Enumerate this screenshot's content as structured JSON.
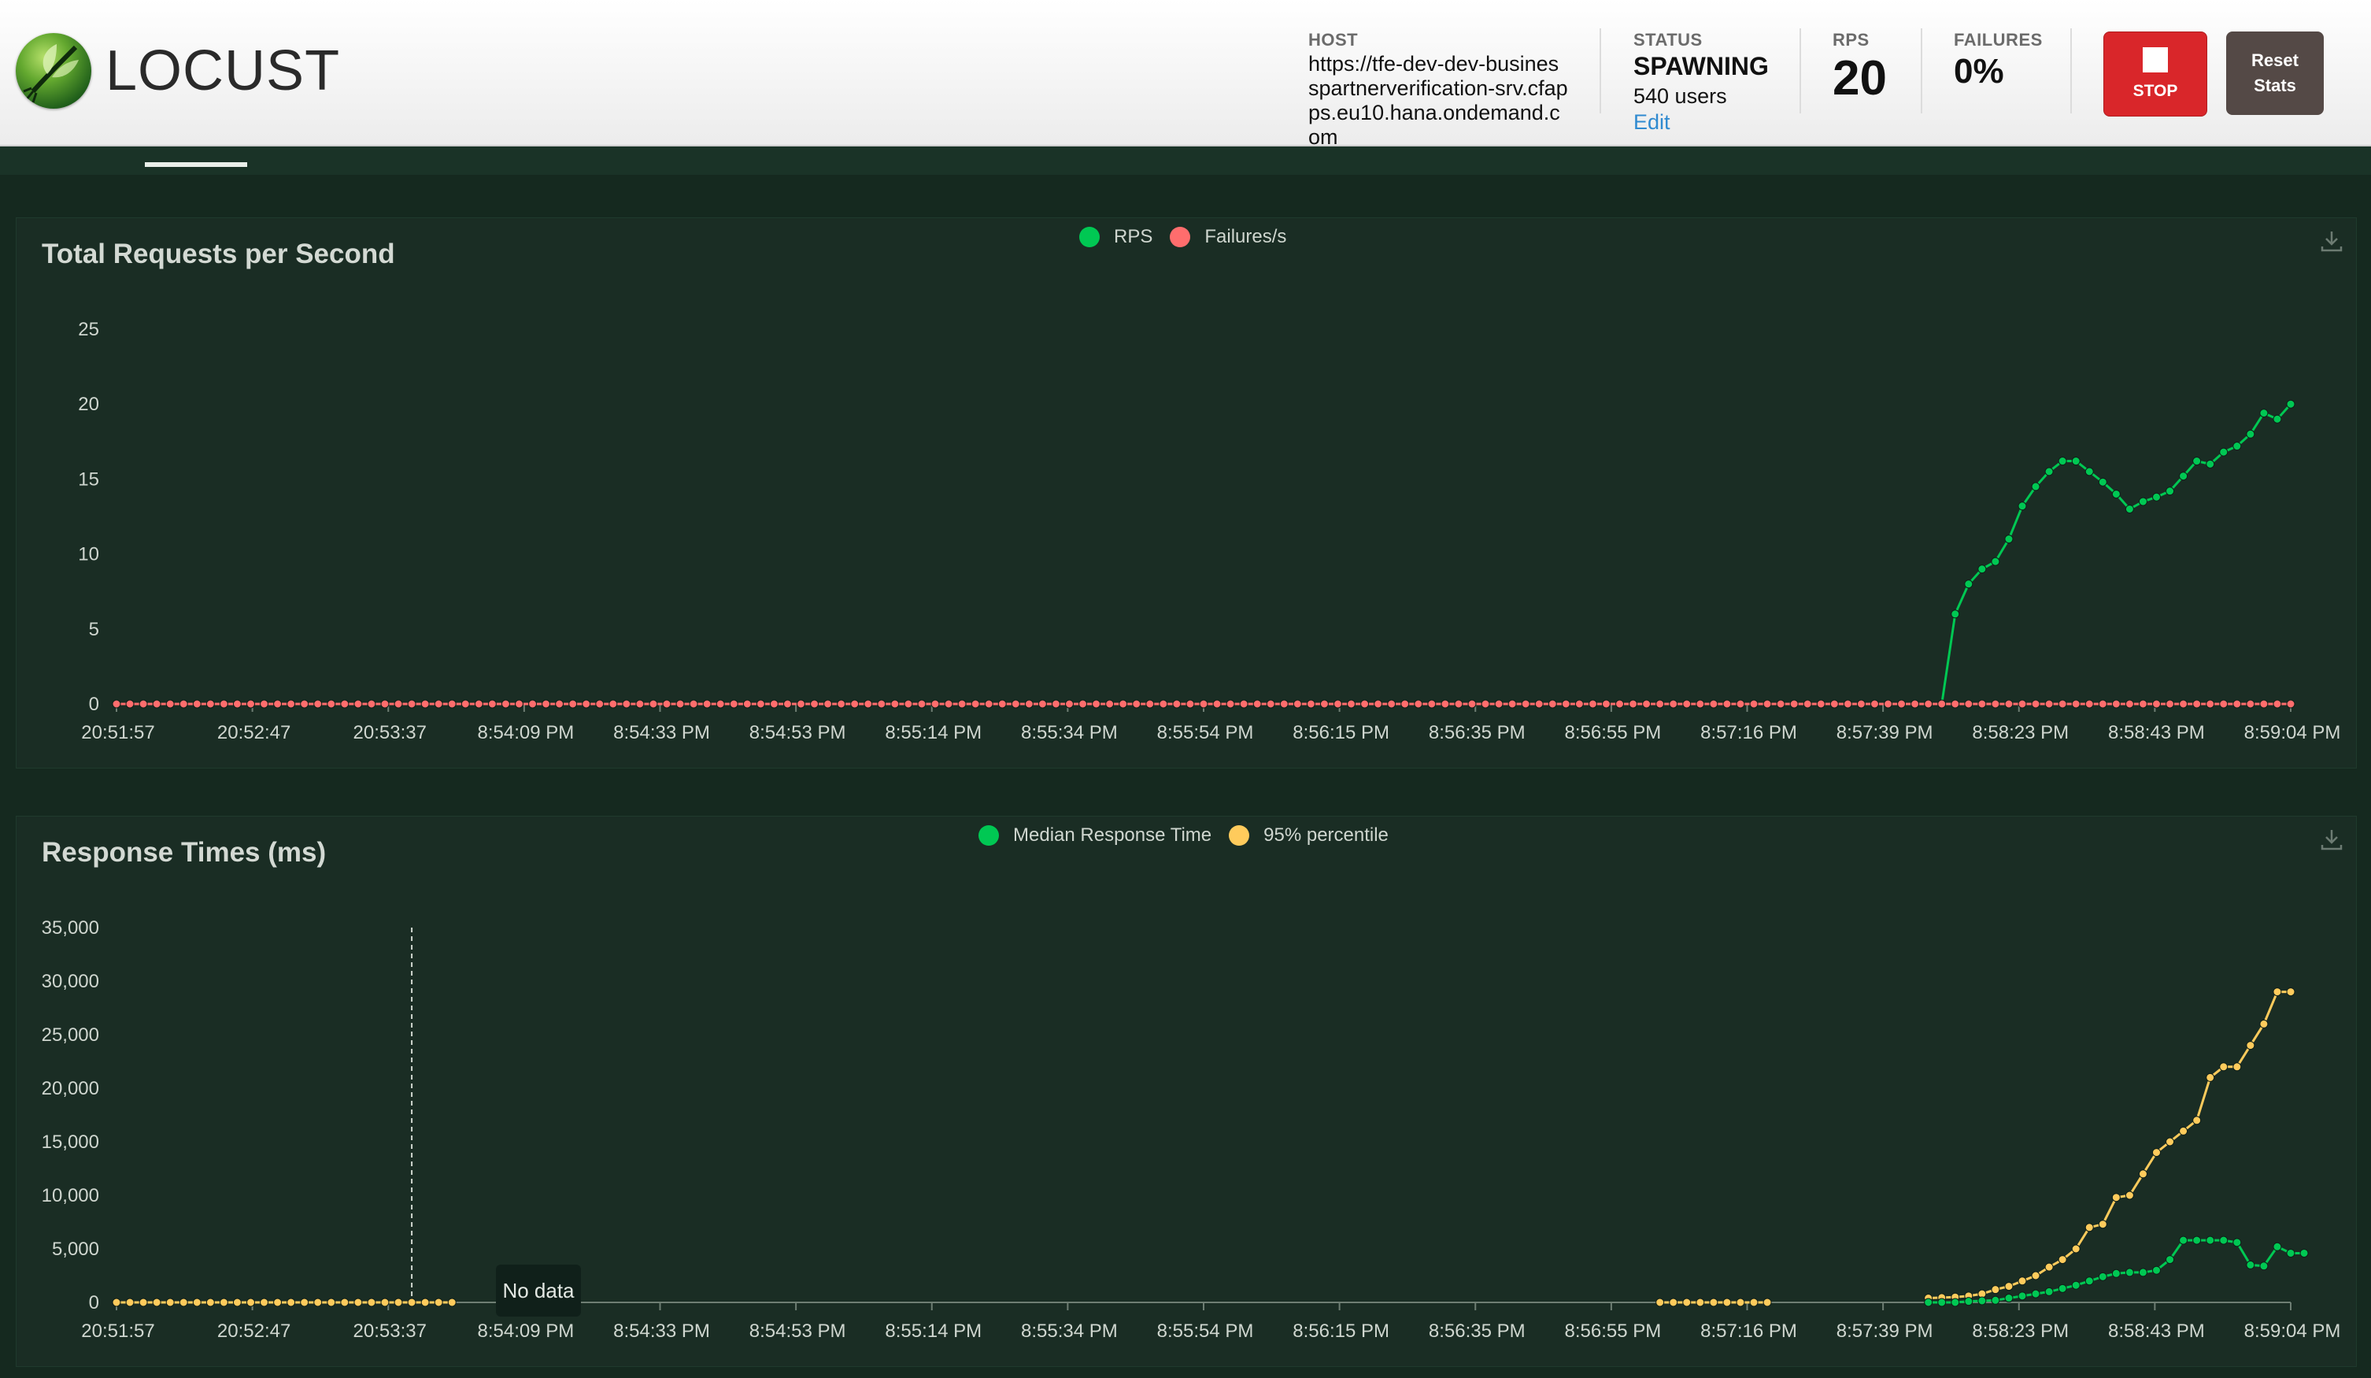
{
  "app": {
    "name": "LOCUST"
  },
  "header": {
    "host": {
      "label": "HOST",
      "value": "https://tfe-dev-dev-businesspartnerverification-srv.cfapps.eu10.hana.ondemand.com"
    },
    "status": {
      "label": "STATUS",
      "value": "SPAWNING",
      "users": "540 users",
      "edit_label": "Edit"
    },
    "rps": {
      "label": "RPS",
      "value": "20"
    },
    "failures": {
      "label": "FAILURES",
      "value": "0%"
    },
    "stop_label": "STOP",
    "reset_label": "Reset Stats"
  },
  "tooltip": {
    "text": "No data"
  },
  "colors": {
    "green": "#00c853",
    "red": "#ff6d6d",
    "yellow": "#ffcb5c",
    "panel": "#1a2d24"
  },
  "chart_data": [
    {
      "type": "line",
      "title": "Total Requests per Second",
      "x_tick_labels": [
        "20:51:57",
        "20:52:47",
        "20:53:37",
        "8:54:09 PM",
        "8:54:33 PM",
        "8:54:53 PM",
        "8:55:14 PM",
        "8:55:34 PM",
        "8:55:54 PM",
        "8:56:15 PM",
        "8:56:35 PM",
        "8:56:55 PM",
        "8:57:16 PM",
        "8:57:39 PM",
        "8:58:23 PM",
        "8:58:43 PM",
        "8:59:04 PM"
      ],
      "ylim": [
        0,
        25
      ],
      "y_ticks": [
        "0",
        "5",
        "10",
        "15",
        "20",
        "25"
      ],
      "legend": [
        "RPS",
        "Failures/s"
      ],
      "n_points": 163,
      "series": [
        {
          "name": "RPS",
          "color": "#00c853",
          "start_index": 136,
          "values": [
            0,
            6,
            8,
            9,
            9.5,
            11,
            13.2,
            14.5,
            15.5,
            16.2,
            16.2,
            15.5,
            14.8,
            14,
            13,
            13.5,
            13.8,
            14.2,
            15.2,
            16.2,
            16,
            16.8,
            17.2,
            18,
            19.4,
            19,
            20
          ]
        },
        {
          "name": "Failures/s",
          "color": "#ff6d6d",
          "start_index": 0,
          "constant": 0
        }
      ]
    },
    {
      "type": "line",
      "title": "Response Times (ms)",
      "x_tick_labels": [
        "20:51:57",
        "20:52:47",
        "20:53:37",
        "8:54:09 PM",
        "8:54:33 PM",
        "8:54:53 PM",
        "8:55:14 PM",
        "8:55:34 PM",
        "8:55:54 PM",
        "8:56:15 PM",
        "8:56:35 PM",
        "8:56:55 PM",
        "8:57:16 PM",
        "8:57:39 PM",
        "8:58:23 PM",
        "8:58:43 PM",
        "8:59:04 PM"
      ],
      "ylim": [
        0,
        35000
      ],
      "y_ticks": [
        "0",
        "5,000",
        "10,000",
        "15,000",
        "20,000",
        "25,000",
        "30,000",
        "35,000"
      ],
      "legend": [
        "Median Response Time",
        "95% percentile"
      ],
      "n_points": 163,
      "segments_95": [
        {
          "start_index": 0,
          "values": [
            0,
            0,
            0,
            0,
            0,
            0,
            0,
            0,
            0,
            0,
            0,
            0,
            0,
            0,
            0,
            0,
            0,
            0,
            0,
            0,
            0,
            0,
            0,
            0,
            0,
            0
          ]
        },
        {
          "start_index": 115,
          "values": [
            0,
            0,
            0,
            0,
            0,
            0,
            0,
            0,
            0
          ]
        },
        {
          "start_index": 135,
          "values": [
            400,
            450,
            500,
            600,
            800,
            1200,
            1500,
            2000,
            2500,
            3300,
            4000,
            5000,
            7000,
            7300,
            9800,
            10000,
            12000,
            14000,
            15000,
            16000,
            17000,
            21000,
            22000,
            22000,
            24000,
            26000,
            29000,
            29000
          ]
        }
      ],
      "median": {
        "start_index": 135,
        "values": [
          0,
          0,
          0,
          100,
          150,
          200,
          400,
          600,
          800,
          1000,
          1300,
          1600,
          2000,
          2400,
          2700,
          2800,
          2800,
          3000,
          4000,
          5800,
          5800,
          5800,
          5800,
          5600,
          3500,
          3400,
          5200,
          4600,
          4600
        ]
      },
      "crosshair_index": 22
    }
  ]
}
